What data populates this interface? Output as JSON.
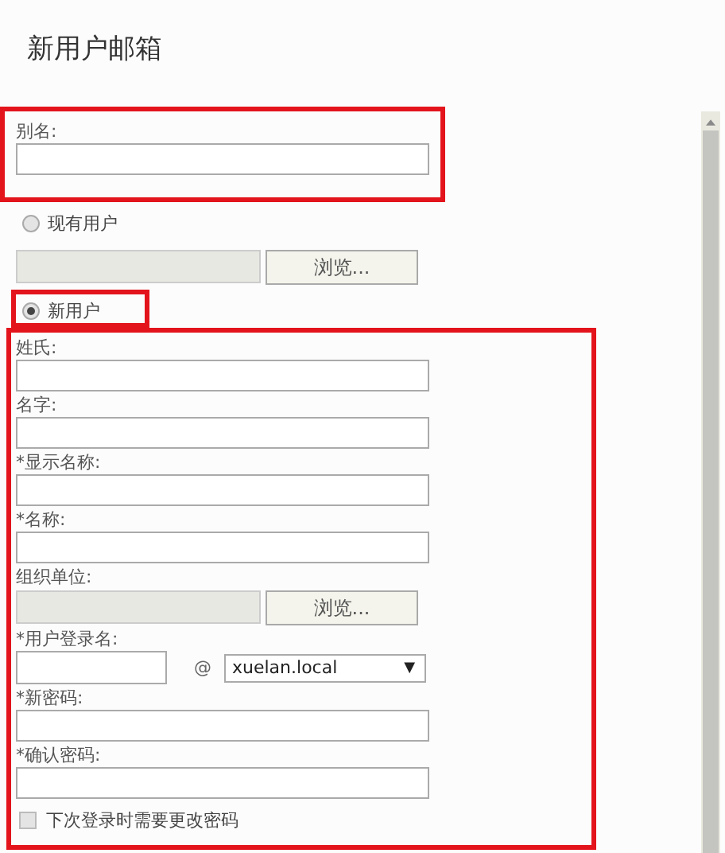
{
  "title": "新用户邮箱",
  "alias": {
    "label": "别名:"
  },
  "existing_user": {
    "label": "现有用户",
    "selected": false,
    "button": "浏览..."
  },
  "new_user": {
    "label": "新用户",
    "selected": true
  },
  "fields": [
    {
      "kind": "text",
      "label": "姓氏:"
    },
    {
      "kind": "text",
      "label": "名字:"
    },
    {
      "kind": "text",
      "label": "*显示名称:"
    },
    {
      "kind": "text",
      "label": "*名称:"
    },
    {
      "kind": "browse",
      "label": "组织单位:",
      "button": "浏览..."
    },
    {
      "kind": "login",
      "label": "*用户登录名:",
      "at": "@",
      "domain": "xuelan.local",
      "caret": "▼"
    },
    {
      "kind": "text",
      "label": "*新密码:"
    },
    {
      "kind": "text",
      "label": "*确认密码:"
    }
  ],
  "change_password": {
    "label": "下次登录时需要更改密码",
    "checked": false
  }
}
